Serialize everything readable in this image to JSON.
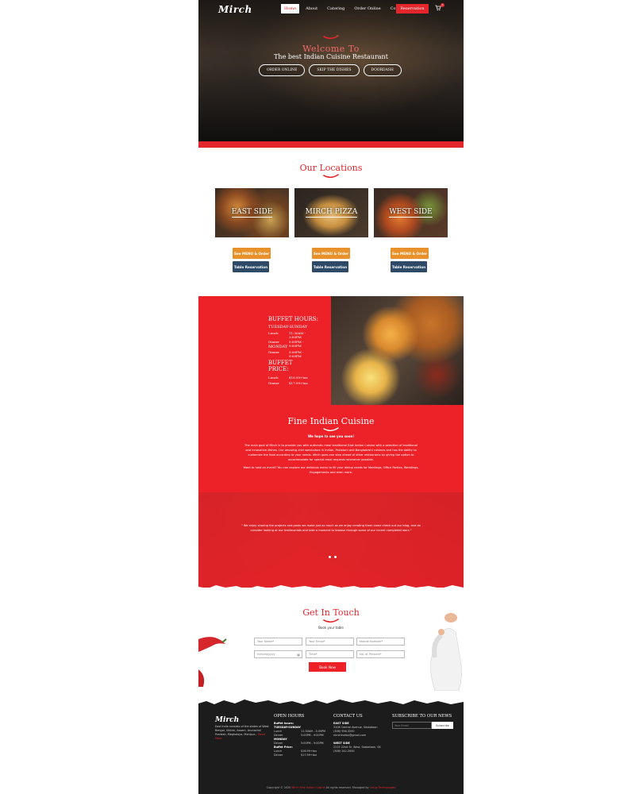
{
  "header": {
    "logo": "Mirch",
    "nav": [
      "Home",
      "About",
      "Catering",
      "Order Online",
      "Contact Us"
    ],
    "active_nav": "Home",
    "reservation": "Reservation",
    "cart_count": "0"
  },
  "hero": {
    "title": "Welcome To",
    "subtitle": "The best Indian Cuisine Restaurant",
    "buttons": [
      "ORDER ONLINE",
      "SKIP THE DISHES",
      "DOORDASH"
    ]
  },
  "locations": {
    "title": "Our Locations",
    "cards": [
      {
        "name": "EAST SIDE",
        "menu_btn": "See MENU & Order",
        "res_btn": "Table Reservation"
      },
      {
        "name": "MIRCH PIZZA",
        "menu_btn": "See MENU & Order",
        "res_btn": "Table Reservation"
      },
      {
        "name": "WEST SIDE",
        "menu_btn": "See MENU & Order",
        "res_btn": "Table Reservation"
      }
    ]
  },
  "buffet": {
    "title": "BUFFET HOURS:",
    "days1": "TUESDAY-SUNDAY",
    "lunch_label": "Lunch",
    "lunch_time": "11:30AM - 3:00PM",
    "dinner_label": "Dinner",
    "dinner_time": "5:00PM - 9:00PM",
    "days2": "MONDAY",
    "monday_dinner": "5:00PM - 9:00PM",
    "price_title": "BUFFET PRICE:",
    "lunch_price": "$16.99+tax",
    "dinner_price": "$17.99+tax"
  },
  "fine": {
    "title": "Fine Indian Cuisine",
    "subtitle": "We hope to see you soon!",
    "text1": "The main goal of Mirch is to provide you with authentic meal traditional East Indian Cuisine with a selection of traditional and innovative dishes. Our amazing chef specialises in Indian, Pakistani and Bangladeshi cuisines and has the ability to customize the food according to your needs. Mirch goes one step ahead of other restaurants by giving the option to accommodate for special meal requests whenever possible.",
    "text2": "Want to host an event? You can explore our delicious menu to fill your dining needs for Meetings, Office Parties, Weddings, Engagements and even more."
  },
  "testimonial": {
    "text": "\" We enjoy sharing the projects and posts we make just as much as we enjoy creating them come check out our blog, and do consider looking at our testimonials and take a moment to browse through some of our recent completed work.\""
  },
  "contact": {
    "title": "Get In Touch",
    "subtitle": "Book your table",
    "fields": [
      "Your Name*",
      "Your Email*",
      "Mobile Number*",
      "mm/dd/yyyy",
      "Time*",
      "No. of Persons*"
    ],
    "button": "Book Now"
  },
  "footer": {
    "logo": "Mirch",
    "about": "East India consists of the states of West Bengal, Sikkim, Assam, Arunachal Pradesh, Meghalaya, Manipur... ",
    "read_more": "Read More",
    "open_title": "OPEN HOURS",
    "open_lines": [
      {
        "label": "Buffet hours:",
        "value": "",
        "bold": true
      },
      {
        "label": "TUESDAY-SUNDAY",
        "value": "",
        "bold": true
      },
      {
        "label": "Lunch",
        "value": "11:30AM - 3:00PM",
        "bold": false
      },
      {
        "label": "Dinner",
        "value": "5:00PM - 9:00PM",
        "bold": false
      },
      {
        "label": "MONDAY",
        "value": "",
        "bold": true
      },
      {
        "label": "Dinner",
        "value": "5:00PM - 9:00PM",
        "bold": false
      },
      {
        "label": "Buffet Price:",
        "value": "",
        "bold": true
      },
      {
        "label": "Lunch",
        "value": "$16.99+tax",
        "bold": false
      },
      {
        "label": "Dinner",
        "value": "$17.99+tax",
        "bold": false
      }
    ],
    "contact_title": "CONTACT US",
    "east_label": "EAST SIDE",
    "east_lines": [
      "3106 Central Avenue, Saskatoon",
      "(306) 956-3200",
      "mirchindian@gmail.com"
    ],
    "west_label": "WEST SIDE",
    "west_lines": [
      "2115 22nd St. West, Saskatoon, SK",
      "(306) 242-2000"
    ],
    "news_title": "SUBSCRIBE TO OUR NEWS",
    "email_placeholder": "Your Email",
    "subscribe": "Subscribe",
    "copyright_pre": "Copyright © 2020 ",
    "copyright_brand": "Mirch Fine Indian Cuisine",
    "copyright_mid": " All rights reserved. Managed by ",
    "copyright_company": "Lexus Technologies"
  },
  "colors": {
    "brand_red": "#e3262b",
    "orange": "#e8912a",
    "navy": "#2f4a66",
    "dark": "#1c1c1c"
  }
}
